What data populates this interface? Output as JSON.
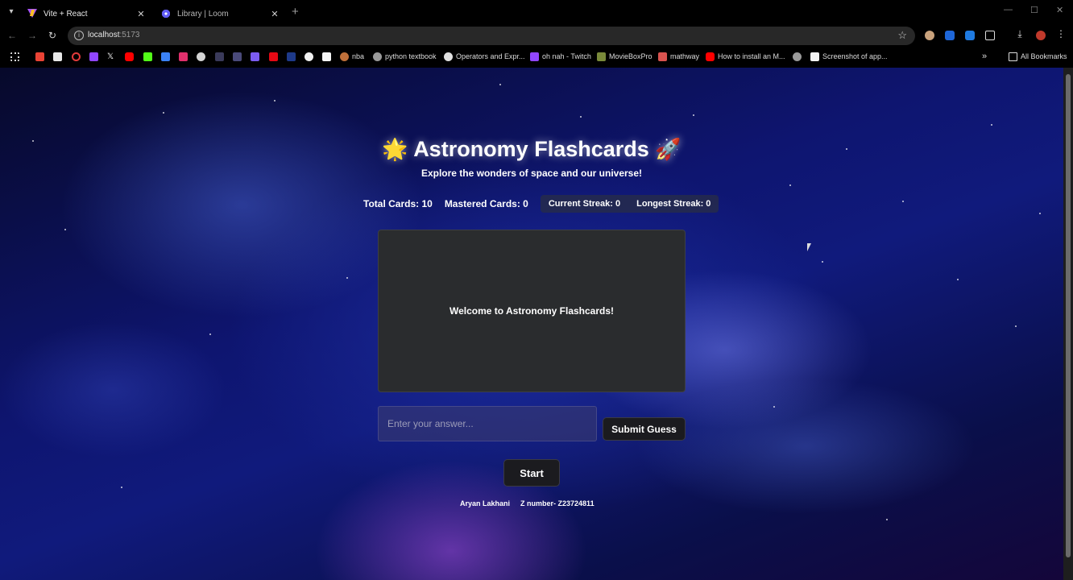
{
  "browser": {
    "tabs": [
      {
        "title": "Vite + React",
        "active": true,
        "icon": "vite-icon"
      },
      {
        "title": "Library | Loom",
        "active": false,
        "icon": "loom-icon"
      }
    ],
    "url_host": "localhost",
    "url_port": ":5173",
    "bookmarks": [
      {
        "label": "nba",
        "icon": "nba-icon"
      },
      {
        "label": "python textbook",
        "icon": "globe-icon"
      },
      {
        "label": "Operators and Expr...",
        "icon": "operators-icon"
      },
      {
        "label": "oh nah - Twitch",
        "icon": "twitch-icon"
      },
      {
        "label": "MovieBoxPro",
        "icon": "moviebox-icon"
      },
      {
        "label": "mathway",
        "icon": "mathway-icon"
      },
      {
        "label": "How to install an M...",
        "icon": "youtube-icon"
      },
      {
        "label": "Screenshot of app...",
        "icon": "screenshot-icon"
      }
    ],
    "all_bookmarks_label": "All Bookmarks"
  },
  "app": {
    "title": "Astronomy Flashcards",
    "title_emoji_left": "🌟",
    "title_emoji_right": "🚀",
    "subtitle": "Explore the wonders of space and our universe!",
    "stats": {
      "total_cards": "Total Cards: 10",
      "mastered_cards": "Mastered Cards: 0",
      "current_streak": "Current Streak: 0",
      "longest_streak": "Longest Streak: 0"
    },
    "card_text": "Welcome to Astronomy Flashcards!",
    "answer_placeholder": "Enter your answer...",
    "submit_label": "Submit Guess",
    "start_label": "Start",
    "footer_name": "Aryan Lakhani",
    "footer_id": "Z number- Z23724811"
  },
  "colors": {
    "space_blue": "#101a7c",
    "nebula_purple": "#aa50e6",
    "card_bg": "#2a2c2e",
    "button_bg": "#1b1b1f"
  }
}
